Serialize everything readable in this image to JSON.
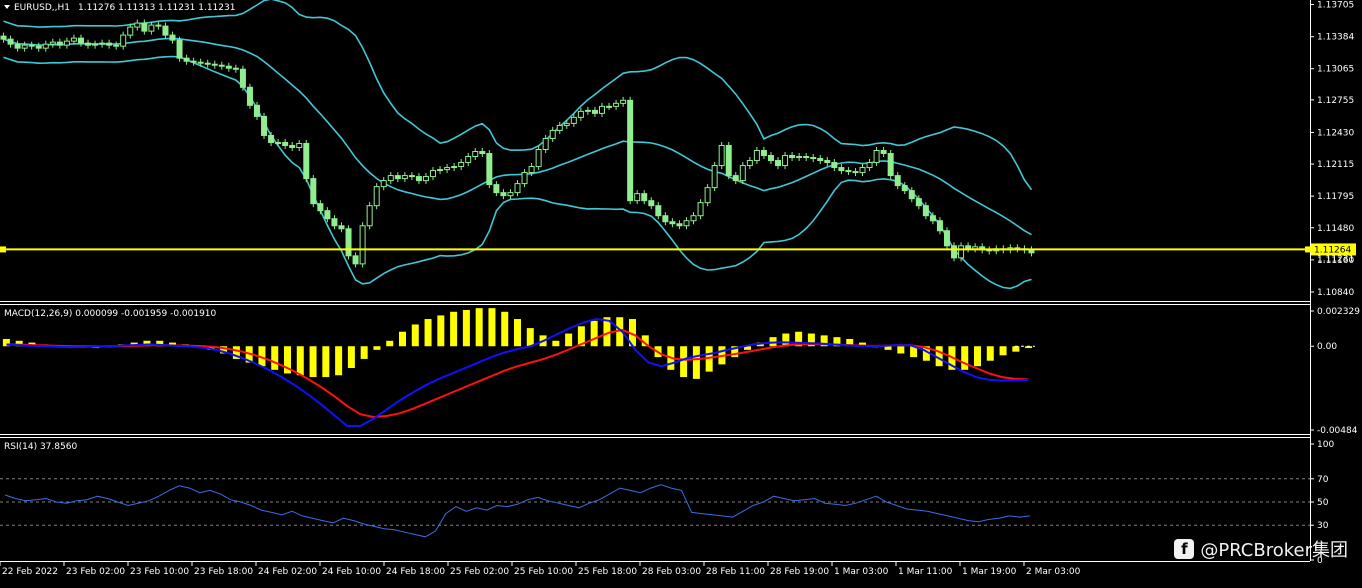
{
  "header": {
    "symbol": "EURUSD,,H1",
    "ohlc": "1.11276 1.11313 1.11231 1.11231",
    "macd_label": "MACD(12,26,9) 0.000099 -0.001959 -0.001910",
    "rsi_label": "RSI(14) 37.8560"
  },
  "watermark": {
    "text": "@PRCBroker集团",
    "icon": "facebook-icon"
  },
  "colors": {
    "background": "#000000",
    "candle": "#90ee90",
    "bollinger": "#40c8d8",
    "price_line": "#ffff00",
    "macd_hist": "#ffff00",
    "macd_line": "#1010ff",
    "signal_line": "#ff1010",
    "rsi": "#3a6ee8",
    "grid": "#808080"
  },
  "price_axis": {
    "ticks": [
      "1.13705",
      "1.13384",
      "1.13065",
      "1.12755",
      "1.12430",
      "1.12115",
      "1.11795",
      "1.11480",
      "1.11160",
      "1.10840"
    ],
    "current_price": "1.11264",
    "current_price_2": "1.11231"
  },
  "macd_axis": {
    "ticks": [
      "0.002329",
      "0.00",
      "-0.00484"
    ]
  },
  "rsi_axis": {
    "ticks": [
      "100",
      "70",
      "50",
      "30",
      "0"
    ]
  },
  "time_axis": {
    "labels": [
      "22 Feb 2022",
      "23 Feb 02:00",
      "23 Feb 10:00",
      "23 Feb 18:00",
      "24 Feb 02:00",
      "24 Feb 10:00",
      "24 Feb 18:00",
      "25 Feb 02:00",
      "25 Feb 10:00",
      "25 Feb 18:00",
      "28 Feb 03:00",
      "28 Feb 11:00",
      "28 Feb 19:00",
      "1 Mar 03:00",
      "1 Mar 11:00",
      "1 Mar 19:00",
      "2 Mar 03:00"
    ]
  },
  "chart_data": [
    {
      "type": "candlestick",
      "symbol": "EURUSD",
      "timeframe": "H1",
      "ylim": [
        1.1075,
        1.1375
      ],
      "close": [
        1.1336,
        1.1331,
        1.1327,
        1.133,
        1.1329,
        1.1327,
        1.1331,
        1.1333,
        1.133,
        1.1334,
        1.1337,
        1.1332,
        1.133,
        1.1331,
        1.1332,
        1.133,
        1.1329,
        1.134,
        1.1348,
        1.1352,
        1.1344,
        1.135,
        1.1349,
        1.134,
        1.1335,
        1.1317,
        1.1314,
        1.1313,
        1.1312,
        1.1311,
        1.131,
        1.1309,
        1.1307,
        1.1306,
        1.1288,
        1.127,
        1.1259,
        1.124,
        1.1233,
        1.1233,
        1.123,
        1.1228,
        1.1232,
        1.1197,
        1.1172,
        1.1165,
        1.1157,
        1.115,
        1.1147,
        1.112,
        1.1112,
        1.115,
        1.117,
        1.1189,
        1.1195,
        1.12,
        1.1197,
        1.12,
        1.1199,
        1.1195,
        1.1199,
        1.1205,
        1.1206,
        1.1208,
        1.1209,
        1.1213,
        1.1219,
        1.1224,
        1.1222,
        1.1191,
        1.1183,
        1.118,
        1.1183,
        1.1192,
        1.1203,
        1.1209,
        1.1226,
        1.1237,
        1.1245,
        1.125,
        1.1252,
        1.1258,
        1.1264,
        1.1265,
        1.1262,
        1.1269,
        1.1269,
        1.1272,
        1.1275,
        1.1175,
        1.1182,
        1.1175,
        1.117,
        1.116,
        1.1154,
        1.1152,
        1.115,
        1.1155,
        1.116,
        1.1173,
        1.1188,
        1.121,
        1.123,
        1.12,
        1.1195,
        1.121,
        1.1215,
        1.1225,
        1.122,
        1.1215,
        1.121,
        1.122,
        1.1218,
        1.1219,
        1.1218,
        1.1217,
        1.1215,
        1.1213,
        1.1208,
        1.1205,
        1.1204,
        1.1203,
        1.1208,
        1.1213,
        1.1225,
        1.1222,
        1.12,
        1.119,
        1.1185,
        1.1177,
        1.117,
        1.116,
        1.1155,
        1.1145,
        1.113,
        1.1118,
        1.113,
        1.1127,
        1.1129,
        1.1126,
        1.1125,
        1.1127,
        1.1126,
        1.1128,
        1.1127,
        1.1126,
        1.1123
      ]
    },
    {
      "type": "line",
      "name": "MACD(12,26,9)",
      "ylim": [
        -0.00484,
        0.002329
      ],
      "values": [
        8e-05,
        5e-05,
        2e-05,
        0.0,
        -3e-05,
        -5e-05,
        -4e-05,
        -2e-05,
        1e-05,
        4e-05,
        7e-05,
        0.0001,
        6e-05,
        2e-05,
        -2e-05,
        -8e-05,
        -0.0002,
        -0.0004,
        -0.00065,
        -0.00095,
        -0.0013,
        -0.0017,
        -0.00215,
        -0.00265,
        -0.0032,
        -0.0038,
        -0.0044,
        -0.0044,
        -0.004,
        -0.0035,
        -0.003,
        -0.00255,
        -0.00215,
        -0.0018,
        -0.0015,
        -0.0012,
        -0.0009,
        -0.0006,
        -0.00035,
        -0.00015,
        0.0,
        0.0003,
        0.00065,
        0.001,
        0.0013,
        0.0015,
        0.0014,
        0.0008,
        -0.0002,
        -0.0009,
        -0.0011,
        -0.0009,
        -0.00065,
        -0.0005,
        -0.00038,
        -0.0002,
        -5e-05,
        0.0001,
        0.00018,
        0.00022,
        0.0002,
        0.00018,
        0.00015,
        0.0001,
        5e-05,
        2e-05,
        0.0,
        3e-05,
        5e-05,
        5e-05,
        -0.0002,
        -0.0006,
        -0.001,
        -0.0014,
        -0.0017,
        -0.00185,
        -0.0019,
        -0.00188,
        -0.00185
      ]
    },
    {
      "type": "line",
      "name": "Signal",
      "values": [
        0.0001,
        8e-05,
        6e-05,
        4e-05,
        2e-05,
        0.0,
        -1e-05,
        -1e-05,
        0.0,
        1e-05,
        3e-05,
        5e-05,
        5e-05,
        4e-05,
        3e-05,
        1e-05,
        -5e-05,
        -0.00015,
        -0.0003,
        -0.0005,
        -0.00075,
        -0.00105,
        -0.0014,
        -0.0018,
        -0.00225,
        -0.00275,
        -0.0033,
        -0.00375,
        -0.0039,
        -0.00385,
        -0.0037,
        -0.00345,
        -0.00315,
        -0.00285,
        -0.00255,
        -0.00225,
        -0.00195,
        -0.00165,
        -0.00135,
        -0.0011,
        -0.0009,
        -0.0007,
        -0.00045,
        -0.00015,
        0.00015,
        0.00045,
        0.00075,
        0.0009,
        0.0006,
        0.0,
        -0.00045,
        -0.0007,
        -0.00075,
        -0.0007,
        -0.0006,
        -0.0005,
        -0.00038,
        -0.00025,
        -0.00012,
        0.0,
        8e-05,
        0.00012,
        0.00012,
        0.0001,
        7e-05,
        4e-05,
        2e-05,
        3e-05,
        5e-05,
        5e-05,
        -5e-05,
        -0.00025,
        -0.00055,
        -0.0009,
        -0.0012,
        -0.0015,
        -0.0017,
        -0.0018,
        -0.00183
      ]
    },
    {
      "type": "bar",
      "name": "MACD histogram",
      "values": [
        0.0004,
        0.0003,
        0.0002,
        0.0001,
        0.0,
        -0.0001,
        -0.0001,
        -0.0001,
        0.0,
        0.0001,
        0.0002,
        0.0003,
        0.0003,
        0.0002,
        0.0001,
        0.0,
        -0.0002,
        -0.0004,
        -0.0007,
        -0.0009,
        -0.0011,
        -0.0013,
        -0.0015,
        -0.0016,
        -0.0017,
        -0.0017,
        -0.0016,
        -0.0012,
        -0.0007,
        -0.0002,
        0.0003,
        0.0008,
        0.0012,
        0.0015,
        0.0017,
        0.0019,
        0.002,
        0.0021,
        0.0021,
        0.0019,
        0.0015,
        0.001,
        0.0006,
        0.0003,
        0.0007,
        0.0011,
        0.0014,
        0.0016,
        0.0016,
        0.0015,
        0.0006,
        -0.0006,
        -0.0013,
        -0.0017,
        -0.0018,
        -0.0014,
        -0.001,
        -0.0006,
        -0.0002,
        0.0002,
        0.0005,
        0.0007,
        0.0008,
        0.0007,
        0.0006,
        0.0005,
        0.0004,
        0.0002,
        0.0,
        -0.0002,
        -0.0004,
        -0.0006,
        -0.0008,
        -0.0011,
        -0.0013,
        -0.0013,
        -0.0011,
        -0.0008,
        -0.0005,
        -0.0003,
        -0.0001
      ]
    },
    {
      "type": "line",
      "name": "RSI(14)",
      "ylim": [
        0,
        100
      ],
      "levels": [
        70,
        50,
        30
      ],
      "values": [
        56,
        53,
        51,
        52,
        53,
        50,
        49,
        51,
        52,
        55,
        53,
        50,
        47,
        49,
        51,
        55,
        60,
        64,
        62,
        58,
        60,
        57,
        52,
        50,
        47,
        43,
        41,
        39,
        42,
        38,
        36,
        34,
        32,
        36,
        34,
        31,
        29,
        27,
        26,
        24,
        22,
        20,
        25,
        40,
        46,
        42,
        45,
        43,
        47,
        46,
        48,
        52,
        54,
        51,
        49,
        47,
        45,
        49,
        52,
        57,
        62,
        60,
        58,
        62,
        65,
        62,
        60,
        41,
        40,
        39,
        38,
        37,
        42,
        47,
        50,
        55,
        53,
        51,
        52,
        53,
        49,
        48,
        47,
        49,
        52,
        55,
        50,
        47,
        44,
        43,
        42,
        40,
        38,
        36,
        34,
        33,
        35,
        36,
        38,
        37,
        38
      ]
    }
  ]
}
